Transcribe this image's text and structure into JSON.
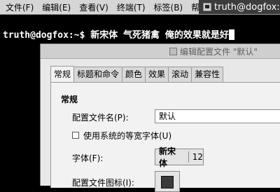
{
  "terminal": {
    "menu": [
      "文件(F)",
      "编辑(E)",
      "查看(V)",
      "终端(T)",
      "标签(B)",
      "帮助(H)"
    ],
    "title": "truth@dogfox:",
    "command_line": "truth@dogfox:~$ 新宋体 气死猪禽 俺的效果就是好"
  },
  "dialog": {
    "title": "编辑配置文件 \"默认\"",
    "tabs": [
      "常规",
      "标题和命令",
      "颜色",
      "效果",
      "滚动",
      "兼容性"
    ],
    "active_tab": "常规",
    "section_title": "常规",
    "profile_name_label": "配置文件名(P):",
    "profile_name_value": "默认",
    "system_font_checkbox_label": "使用系统的等宽字体(U)",
    "system_font_checked": false,
    "font_label": "字体(F):",
    "font_name": "新宋体",
    "font_size": "12",
    "profile_icon_label": "配置文件图标(I):"
  },
  "colors": {
    "terminal_bg": "#000000",
    "terminal_fg": "#ffffff",
    "dialog_bg": "#e8e8e8"
  }
}
